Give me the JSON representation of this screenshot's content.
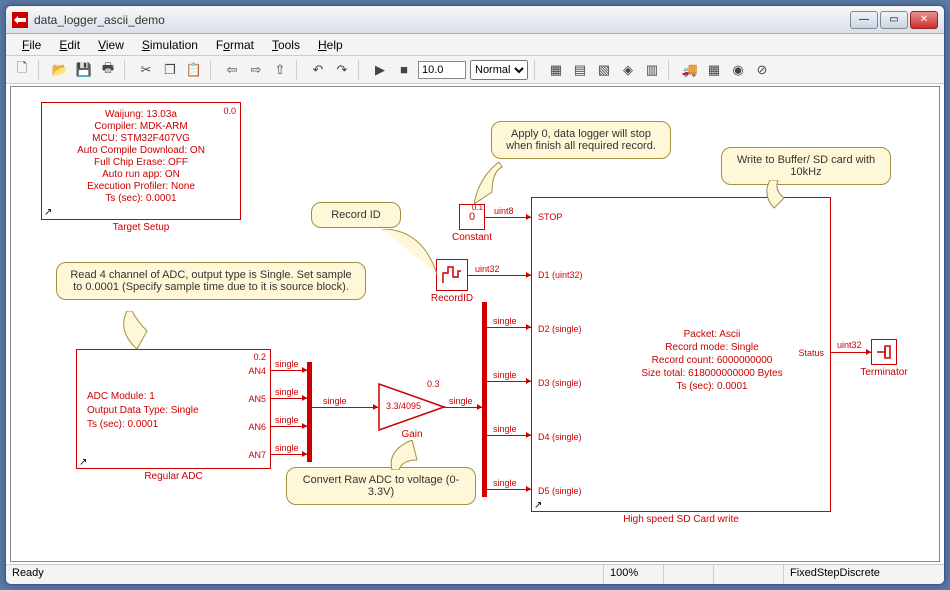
{
  "window": {
    "title": "data_logger_ascii_demo"
  },
  "menu": {
    "file": "File",
    "edit": "Edit",
    "view": "View",
    "simulation": "Simulation",
    "format": "Format",
    "tools": "Tools",
    "help": "Help"
  },
  "toolbar": {
    "stoptime": "10.0",
    "mode": "Normal"
  },
  "status": {
    "ready": "Ready",
    "zoom": "100%",
    "solver": "FixedStepDiscrete"
  },
  "target": {
    "l1": "Waijung: 13.03a",
    "l2": "Compiler: MDK-ARM",
    "l3": "MCU: STM32F407VG",
    "l4": "Auto Compile Download: ON",
    "l5": "Full Chip Erase: OFF",
    "l6": "Auto run app: ON",
    "l7": "Execution Profiler: None",
    "l8": "Ts (sec): 0.0001",
    "label": "Target Setup",
    "num": "0.0"
  },
  "adc": {
    "l1": "ADC Module: 1",
    "l2": "Output Data Type: Single",
    "l3": "Ts (sec): 0.0001",
    "p1": "AN4",
    "p2": "AN5",
    "p3": "AN6",
    "p4": "AN7",
    "label": "Regular ADC",
    "num": "0.2"
  },
  "gain": {
    "txt": "3.3/4095",
    "label": "Gain",
    "num": "0.3"
  },
  "recordid": {
    "label": "RecordID",
    "type": "uint32"
  },
  "constant": {
    "txt": "0",
    "label": "Constant",
    "type": "uint8",
    "num": "0.1"
  },
  "sd": {
    "l1": "Packet: Ascii",
    "l2": "Record mode: Single",
    "l3": "Record count: 6000000000",
    "l4": "Size total: 618000000000 Bytes",
    "l5": "Ts (sec): 0.0001",
    "p_stop": "STOP",
    "p_d1": "D1 (uint32)",
    "p_d2": "D2 (single)",
    "p_d3": "D3 (single)",
    "p_d4": "D4 (single)",
    "p_d5": "D5 (single)",
    "p_status": "Status",
    "label": "High speed SD Card write",
    "statustype": "uint32"
  },
  "term": {
    "label": "Terminator"
  },
  "types": {
    "single": "single"
  },
  "callouts": {
    "recordid": "Record ID",
    "adc": "Read 4 channel of ADC, output type is Single. Set sample to 0.0001 (Specify sample time due to it is source block).",
    "gain": "Convert Raw ADC to voltage (0-3.3V)",
    "const": "Apply 0, data logger will stop when finish all required record.",
    "sd": "Write to Buffer/ SD card with 10kHz"
  }
}
